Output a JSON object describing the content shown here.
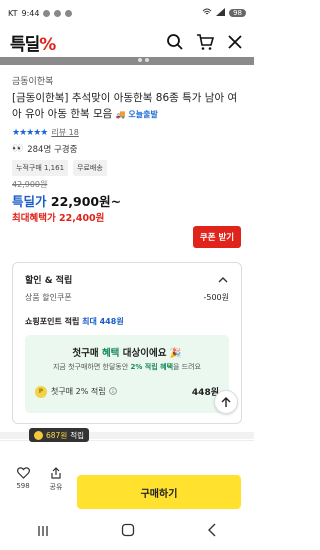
{
  "status": {
    "carrier": "KT",
    "time": "9:44",
    "battery": "98"
  },
  "app": {
    "logo_text": "특딜",
    "logo_pct": "%"
  },
  "product": {
    "brand": "금동이한복",
    "title": "[금동이한복] 추석맞이 아동한복 86종 특가 남아 여아 유아 아동 한복 모음",
    "delivery_badge": "오늘출발",
    "rating_stars": 4.5,
    "review_label": "리뷰 18",
    "subscribers": "284명 구경중",
    "tags": [
      "누적구매 1,161",
      "무료배송"
    ],
    "original_price": "42,900원",
    "special_label": "특딜가",
    "special_price": "22,900원~",
    "max_benefit": "최대혜택가 22,400원",
    "coupon_button": "쿠폰 받기"
  },
  "discount": {
    "heading": "할인 & 적립",
    "coupon_label": "상품 할인쿠폰",
    "coupon_value": "-500원",
    "points_label": "쇼핑포인트 적립",
    "points_value": "최대 448원",
    "promo_title_a": "첫구매 ",
    "promo_title_hl": "혜택",
    "promo_title_b": " 대상이에요",
    "promo_sub_a": "지금 첫구매하면 한달동안 ",
    "promo_sub_hl": "2% 적립 혜택",
    "promo_sub_b": "을 드려요",
    "promo_row_label": "첫구매 2% 적립",
    "promo_row_amount": "448원"
  },
  "bottom": {
    "bubble_points": "687원",
    "bubble_label": "적립",
    "like_count": "598",
    "share_label": "공유",
    "buy_label": "구매하기"
  },
  "colors": {
    "accent_red": "#e0241b",
    "accent_blue": "#1a5dc9",
    "buy_yellow": "#ffe12e",
    "promo_green": "#eaf8ef"
  }
}
